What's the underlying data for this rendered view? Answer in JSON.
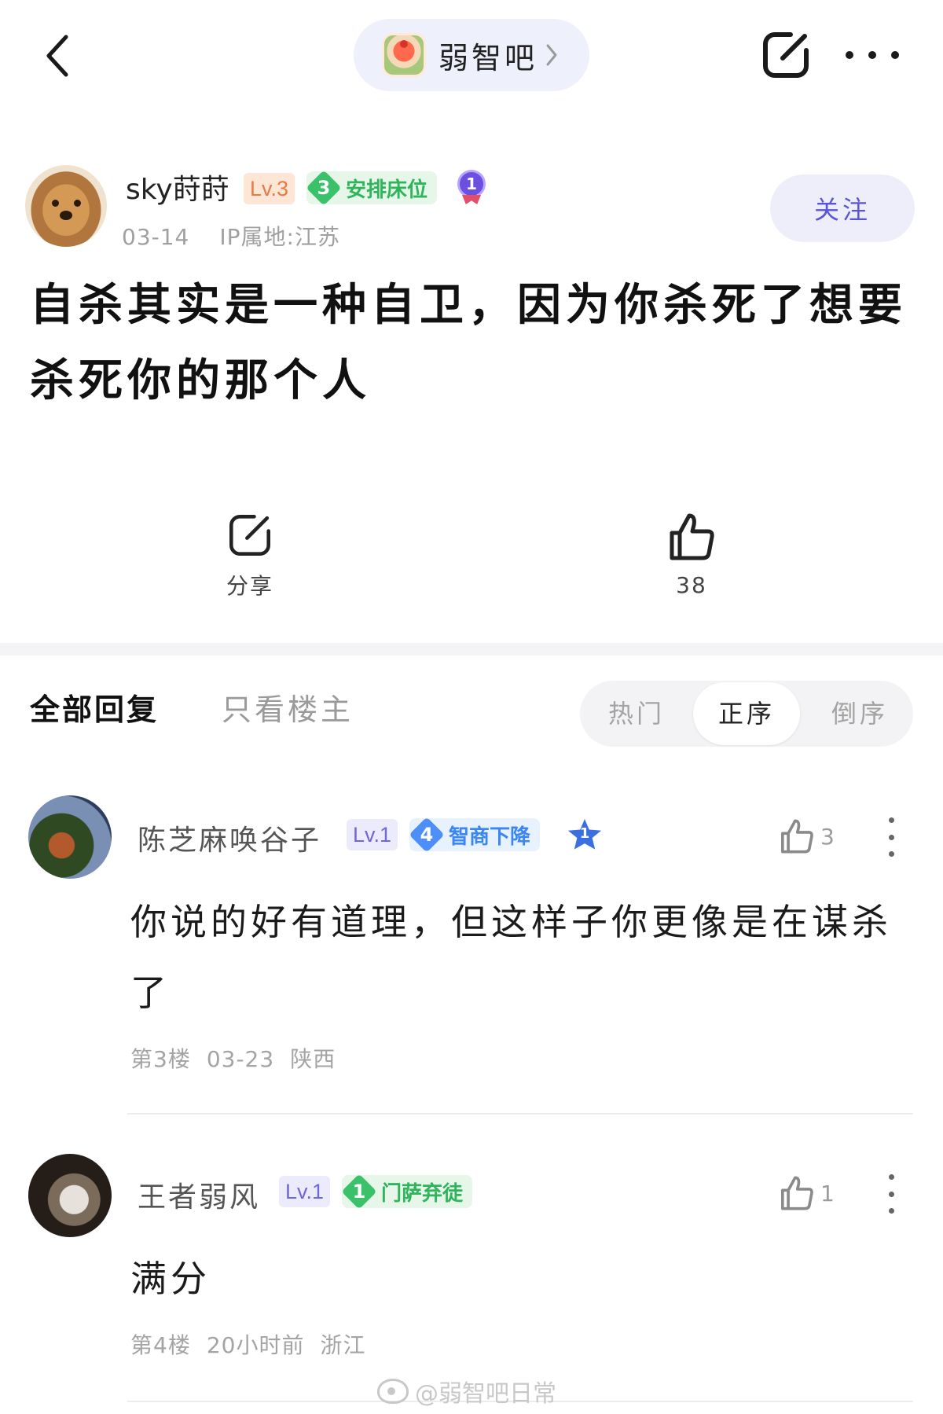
{
  "header": {
    "forum_name": "弱智吧"
  },
  "author": {
    "name": "sky莳莳",
    "level": "Lv.3",
    "title_number": "3",
    "title": "安排床位",
    "medal_number": "1",
    "date": "03-14",
    "ip_location": "IP属地:江苏",
    "follow_label": "关注"
  },
  "post": {
    "text": "自杀其实是一种自卫，因为你杀死了想要杀死你的那个人"
  },
  "actions": {
    "share_label": "分享",
    "like_count": "38"
  },
  "tabs": {
    "all_replies": "全部回复",
    "op_only": "只看楼主",
    "sort_hot": "热门",
    "sort_asc": "正序",
    "sort_desc": "倒序",
    "sort_selected": "正序"
  },
  "replies": [
    {
      "name": "陈芝麻唤谷子",
      "level": "Lv.1",
      "title_number": "4",
      "title": "智商下降",
      "medal_number": "1",
      "likes": "3",
      "text": "你说的好有道理，但这样子你更像是在谋杀了",
      "floor": "第3楼",
      "date": "03-23",
      "location": "陕西"
    },
    {
      "name": "王者弱风",
      "level": "Lv.1",
      "title_number": "1",
      "title": "门萨弃徒",
      "likes": "1",
      "text": "满分",
      "floor": "第4楼",
      "date": "20小时前",
      "location": "浙江"
    }
  ],
  "watermark": "@弱智吧日常",
  "colors": {
    "accent": "#5a54d6",
    "pill_bg": "#eef0fb",
    "badge_green": "#3cc16b",
    "badge_blue": "#4d8ff7",
    "level_orange": "#e57b45"
  }
}
